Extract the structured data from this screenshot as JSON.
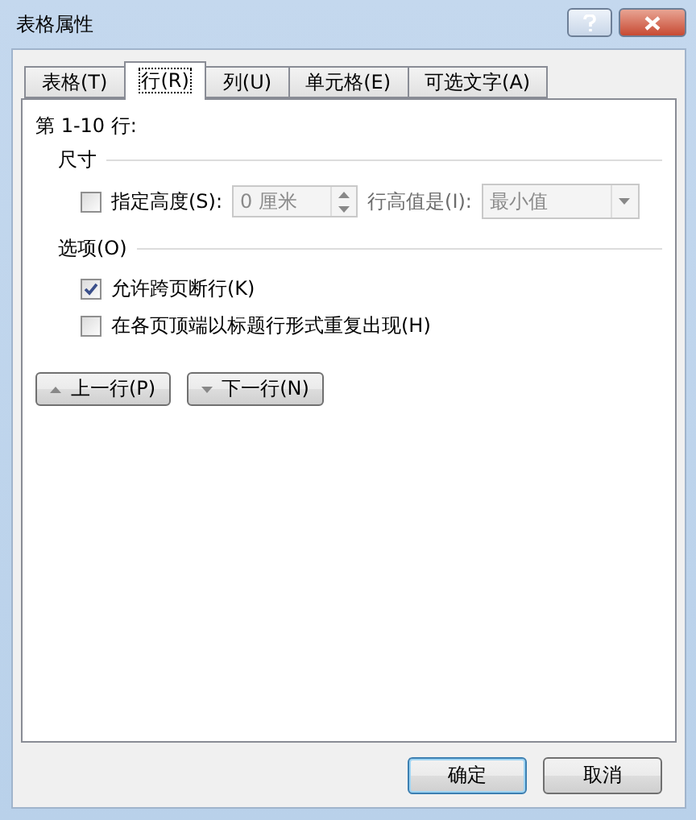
{
  "window": {
    "title": "表格属性"
  },
  "tabs": [
    {
      "label": "表格(T)",
      "selected": false
    },
    {
      "label": "行(R)",
      "selected": true
    },
    {
      "label": "列(U)",
      "selected": false
    },
    {
      "label": "单元格(E)",
      "selected": false
    },
    {
      "label": "可选文字(A)",
      "selected": false
    }
  ],
  "rows_heading": "第 1-10 行:",
  "size_section": {
    "title": "尺寸",
    "specify_height": {
      "label": "指定高度(S):",
      "checked": false
    },
    "height_field": {
      "value": "0 厘米",
      "disabled": true
    },
    "height_rule_label": "行高值是(I):",
    "height_rule_select": {
      "value": "最小值",
      "disabled": true
    }
  },
  "options_section": {
    "title": "选项(O)",
    "options": [
      {
        "label": "允许跨页断行(K)",
        "checked": true
      },
      {
        "label": "在各页顶端以标题行形式重复出现(H)",
        "checked": false
      }
    ]
  },
  "nav_buttons": [
    {
      "label": "上一行(P)",
      "kind": "up"
    },
    {
      "label": "下一行(N)",
      "kind": "down"
    }
  ],
  "buttons": [
    {
      "label": "确定",
      "selected": true
    },
    {
      "label": "取消",
      "selected": false
    }
  ]
}
